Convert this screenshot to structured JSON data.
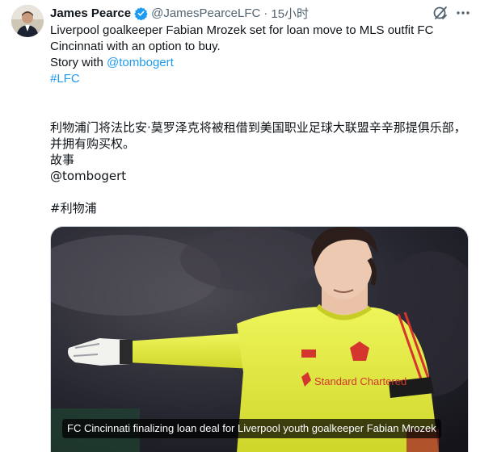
{
  "tweet": {
    "author_name": "James Pearce",
    "author_handle": "@JamesPearceLFC",
    "separator": "·",
    "time": "15小时",
    "text_line1": "Liverpool goalkeeper Fabian Mrozek set for loan move to MLS outfit FC",
    "text_line2": "Cincinnati with an option to buy.",
    "text_line3_prefix": "Story with ",
    "text_line3_link": "@tombogert",
    "hashtag": "#LFC",
    "translation_line1": "利物浦门将法比安·莫罗泽克将被租借到美国职业足球大联盟辛辛那提俱乐部，",
    "translation_line2": "并拥有购买权。",
    "translation_line3": "故事",
    "translation_line4": "@tombogert",
    "translation_hashtag": "#利物浦",
    "media_caption": "FC Cincinnati finalizing loan deal for Liverpool youth goalkeeper Fabian Mrozek",
    "kit_sponsor": "Standard Chartered"
  },
  "icons": {
    "verified": "verified-badge-icon",
    "grok": "grok-icon",
    "more": "more-options-icon"
  },
  "colors": {
    "link": "#1d9bf0",
    "verified": "#1d9bf0",
    "secondary_text": "#536471",
    "jersey": "#e6f03a"
  }
}
